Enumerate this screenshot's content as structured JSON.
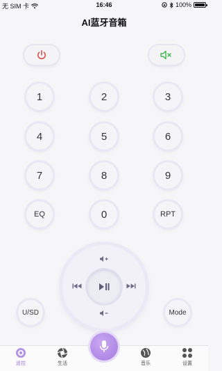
{
  "status_bar": {
    "carrier": "无 SIM 卡",
    "time": "16:46",
    "battery": "100%"
  },
  "header": {
    "title": "AI蓝牙音箱"
  },
  "controls": {
    "power_icon": "power-icon",
    "mute_icon": "speaker-mute-icon"
  },
  "keypad": {
    "k1": "1",
    "k2": "2",
    "k3": "3",
    "k4": "4",
    "k5": "5",
    "k6": "6",
    "k7": "7",
    "k8": "8",
    "k9": "9",
    "eq": "EQ",
    "k0": "0",
    "rpt": "RPT"
  },
  "side": {
    "usd": "U/SD",
    "mode": "Mode"
  },
  "tabs": {
    "remote": "遥控",
    "life": "生活",
    "music": "音乐",
    "settings": "设置"
  },
  "colors": {
    "accent": "#a07ed8",
    "power": "#d9534f",
    "mute": "#3cb44b",
    "icon": "#6e6a86"
  }
}
